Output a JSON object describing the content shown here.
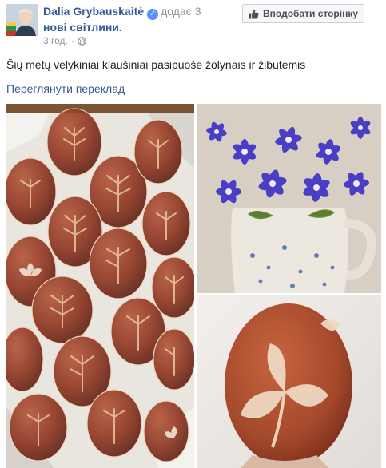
{
  "post": {
    "author_name": "Dalia Grybauskaitė",
    "action_text": "додає 3",
    "photos_link": "нові світлини.",
    "timestamp": "3 год.",
    "separator": "·",
    "privacy_icon": "globe-icon",
    "like_page_button": "Вподобати сторінку",
    "text": "Šių metų velykiniai kiaušiniai pasipuošė žolynais ir žibutėmis",
    "translate_link": "Переглянути переклад"
  },
  "colors": {
    "link": "#365899",
    "meta": "#90949c",
    "text": "#1d2129",
    "verified": "#5890ff"
  },
  "photos": [
    {
      "name": "basket of onion-dyed eggs"
    },
    {
      "name": "blue hepatica flowers in jug"
    },
    {
      "name": "single egg with leaf imprint"
    }
  ]
}
